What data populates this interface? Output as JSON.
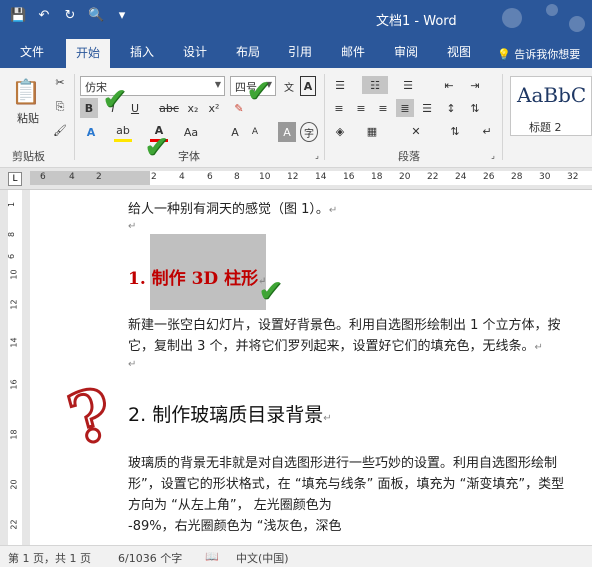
{
  "window": {
    "title": "文档1 - Word"
  },
  "qat": {
    "save": "💾",
    "undo": "↶",
    "redo": "↻",
    "preview": "🔍",
    "more": "▾"
  },
  "tabs": [
    "文件",
    "开始",
    "插入",
    "设计",
    "布局",
    "引用",
    "邮件",
    "审阅",
    "视图"
  ],
  "tellme": "告诉我你想要",
  "clipboard": {
    "paste": "粘贴",
    "group": "剪贴板"
  },
  "font": {
    "name": "仿宋",
    "size": "四号",
    "group": "字体",
    "bold": "B",
    "italic": "I",
    "underline": "U",
    "strike": "abc",
    "sub": "x₂",
    "sup": "x²",
    "aa": "Aa"
  },
  "paragraph": {
    "group": "段落"
  },
  "styles": {
    "sample": "AaBbC",
    "name": "标题 2"
  },
  "ruler": {
    "corner": "L",
    "ticks": [
      "6",
      "4",
      "2",
      "",
      "2",
      "4",
      "6",
      "8",
      "10",
      "12",
      "14",
      "16",
      "18",
      "20",
      "22",
      "24",
      "26",
      "28",
      "30",
      "32"
    ],
    "vticks": [
      "1",
      "8",
      "6",
      "10",
      "12",
      "14",
      "16",
      "18",
      "20",
      "22"
    ]
  },
  "doc": {
    "line1": "给人一种别有洞天的感觉（图 1）。",
    "h1_num": "1.",
    "h1_text": "制作 3D 柱形",
    "para1a": "新建一张空白幻灯片，设置好背景色。利用自选图形绘制出 1 个立方体，按",
    "para1b": "它，复制出 3 个，并将它们罗列起来，设置好它们的填充色，无线条。",
    "h2_num": "2.",
    "h2_text": "制作玻璃质目录背景",
    "para2a": "玻璃质的背景无非就是对自选图形进行一些巧妙的设置。利用自选图形绘制",
    "para2b": "形”，设置它的形状格式，在 “填充与线条” 面板，填充为 “渐变填充”，类型",
    "para2c": "方向为 “从左上角”， 左光圈颜色为",
    "para2d": "-89%，右光圈颜色为 “浅灰色，深色",
    "pilcrow": "↵"
  },
  "status": {
    "page": "第 1 页，共 1 页",
    "words": "6/1036 个字",
    "lang": "中文(中国)"
  },
  "colors": {
    "accent": "#2b579a",
    "heading_red": "#c00000",
    "check": "#3fa535"
  }
}
